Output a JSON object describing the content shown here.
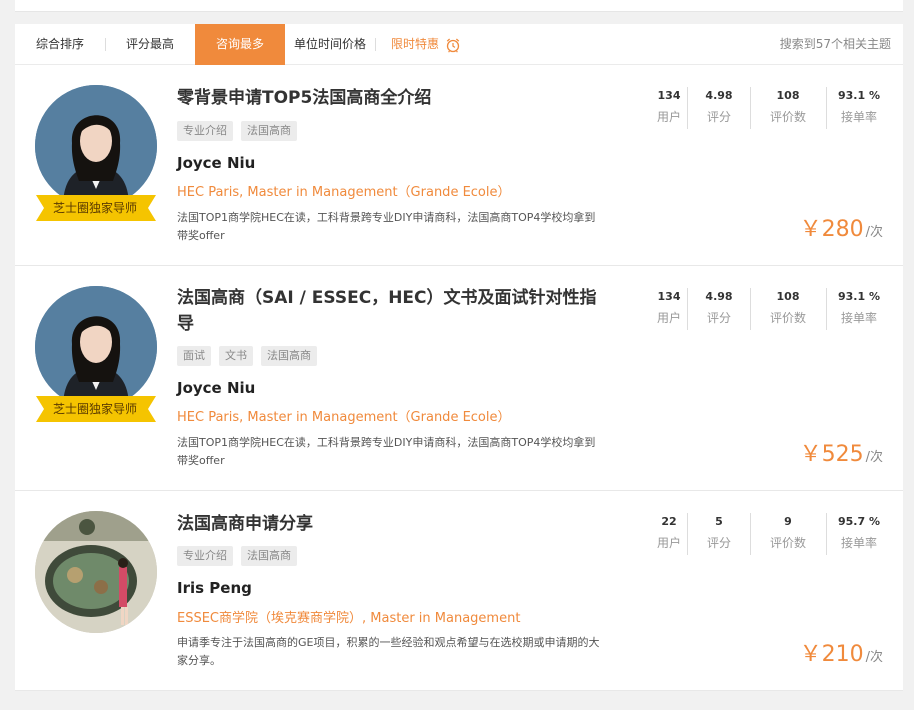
{
  "sortbar": {
    "tabs": [
      "综合排序",
      "评分最高",
      "咨询最多",
      "单位时间价格"
    ],
    "active_index": 2,
    "promo_label": "限时特惠",
    "result_count": "搜索到57个相关主题"
  },
  "colors": {
    "accent": "#f08a3c",
    "ribbon": "#f5c400"
  },
  "cards": [
    {
      "title": "零背景申请TOP5法国高商全介绍",
      "tags": [
        "专业介绍",
        "法国高商"
      ],
      "badge": "芝士圈独家导师",
      "name": "Joyce Niu",
      "school": "HEC Paris, Master in Management（Grande Ecole）",
      "desc": "法国TOP1商学院HEC在读，工科背景跨专业DIY申请商科，法国高商TOP4学校均拿到带奖offer",
      "stats": [
        {
          "value": "134",
          "label": "用户"
        },
        {
          "value": "4.98",
          "label": "评分"
        },
        {
          "value": "108",
          "label": "评价数"
        },
        {
          "value": "93.1 %",
          "label": "接单率"
        }
      ],
      "price": "￥280",
      "price_unit": "/次"
    },
    {
      "title": "法国高商（SAI / ESSEC，HEC）文书及面试针对性指导",
      "tags": [
        "面试",
        "文书",
        "法国高商"
      ],
      "badge": "芝士圈独家导师",
      "name": "Joyce Niu",
      "school": "HEC Paris, Master in Management（Grande Ecole）",
      "desc": "法国TOP1商学院HEC在读，工科背景跨专业DIY申请商科，法国高商TOP4学校均拿到带奖offer",
      "stats": [
        {
          "value": "134",
          "label": "用户"
        },
        {
          "value": "4.98",
          "label": "评分"
        },
        {
          "value": "108",
          "label": "评价数"
        },
        {
          "value": "93.1 %",
          "label": "接单率"
        }
      ],
      "price": "￥525",
      "price_unit": "/次"
    },
    {
      "title": "法国高商申请分享",
      "tags": [
        "专业介绍",
        "法国高商"
      ],
      "name": "Iris Peng",
      "school": "ESSEC商学院（埃克赛商学院）, Master in Management",
      "desc": "申请季专注于法国高商的GE项目，积累的一些经验和观点希望与在选校期或申请期的大家分享。",
      "stats": [
        {
          "value": "22",
          "label": "用户"
        },
        {
          "value": "5",
          "label": "评分"
        },
        {
          "value": "9",
          "label": "评价数"
        },
        {
          "value": "95.7 %",
          "label": "接单率"
        }
      ],
      "price": "￥210",
      "price_unit": "/次"
    }
  ]
}
